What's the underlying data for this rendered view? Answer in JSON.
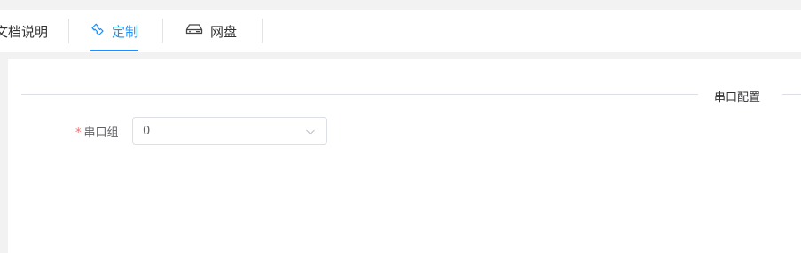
{
  "tabs": [
    {
      "label": "文档说明",
      "icon": "",
      "active": false
    },
    {
      "label": "定制",
      "icon": "customize-icon",
      "active": true
    },
    {
      "label": "网盘",
      "icon": "drive-icon",
      "active": false
    }
  ],
  "section": {
    "title": "串口配置"
  },
  "form": {
    "serial_group": {
      "required_mark": "*",
      "label": "串口组",
      "value": "0"
    }
  },
  "colors": {
    "accent": "#1890ff",
    "required": "#f56c6c"
  }
}
